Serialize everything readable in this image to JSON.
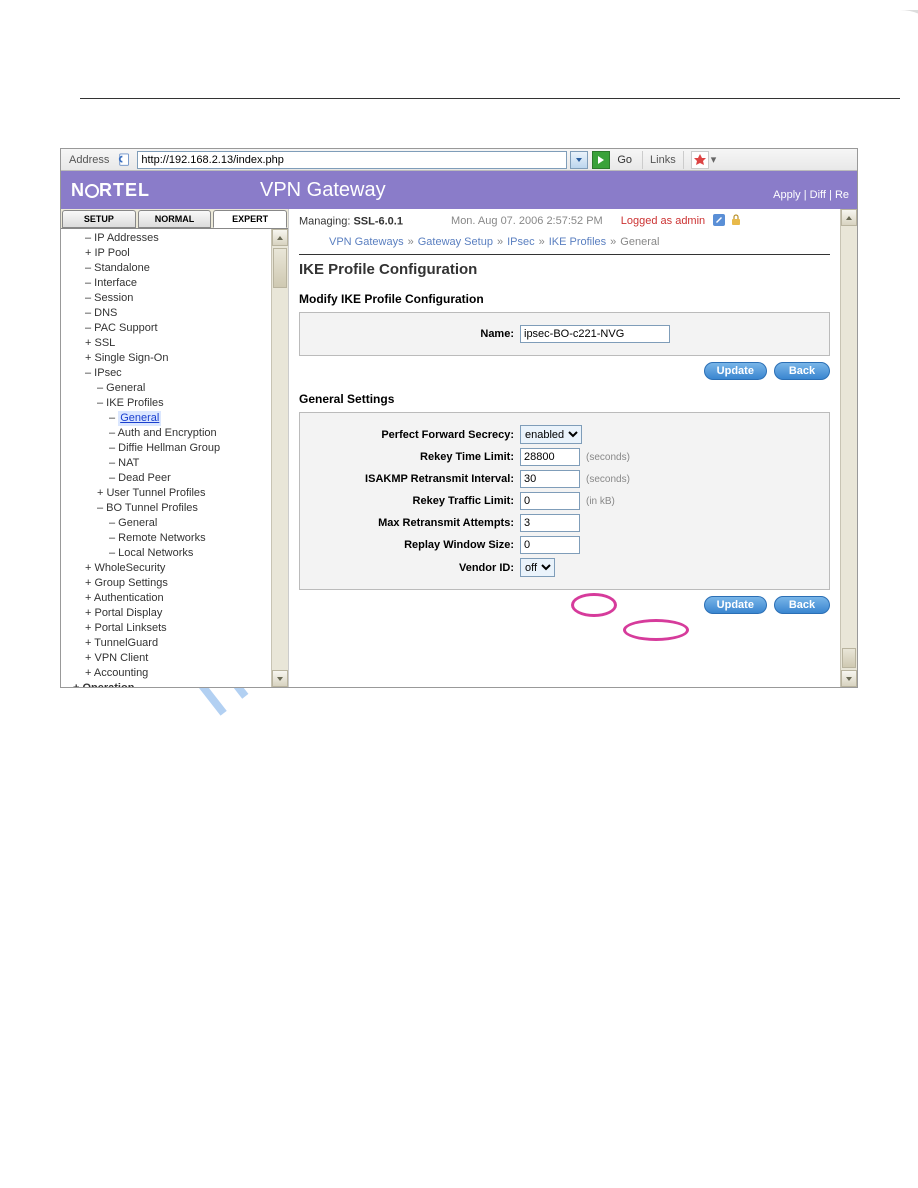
{
  "addressbar": {
    "label": "Address",
    "url": "http://192.168.2.13/index.php",
    "go": "Go",
    "links": "Links"
  },
  "banner": {
    "brand_prefix": "N",
    "brand_suffix": "RTEL",
    "title": "VPN Gateway",
    "apply": "Apply",
    "diff": "Diff",
    "re": "Re"
  },
  "tabs": {
    "setup": "SETUP",
    "normal": "NORMAL",
    "expert": "EXPERT"
  },
  "tree": {
    "items": [
      {
        "lvl": 2,
        "txt": "– IP Addresses"
      },
      {
        "lvl": 2,
        "txt": "+ IP Pool"
      },
      {
        "lvl": 2,
        "txt": "– Standalone"
      },
      {
        "lvl": 2,
        "txt": "– Interface"
      },
      {
        "lvl": 2,
        "txt": "– Session"
      },
      {
        "lvl": 2,
        "txt": "– DNS"
      },
      {
        "lvl": 2,
        "txt": "– PAC Support"
      },
      {
        "lvl": 2,
        "txt": "+ SSL"
      },
      {
        "lvl": 2,
        "txt": "+ Single Sign-On"
      },
      {
        "lvl": 2,
        "txt": "– IPsec"
      },
      {
        "lvl": 3,
        "txt": "– General"
      },
      {
        "lvl": 3,
        "txt": "– IKE Profiles"
      },
      {
        "lvl": 4,
        "txt": "General",
        "sel": true,
        "prefix": "– "
      },
      {
        "lvl": 4,
        "txt": "– Auth and Encryption"
      },
      {
        "lvl": 4,
        "txt": "– Diffie Hellman Group"
      },
      {
        "lvl": 4,
        "txt": "– NAT"
      },
      {
        "lvl": 4,
        "txt": "– Dead Peer"
      },
      {
        "lvl": 3,
        "txt": "+ User Tunnel Profiles"
      },
      {
        "lvl": 3,
        "txt": "– BO Tunnel Profiles"
      },
      {
        "lvl": 4,
        "txt": "– General"
      },
      {
        "lvl": 4,
        "txt": "– Remote Networks"
      },
      {
        "lvl": 4,
        "txt": "– Local Networks"
      },
      {
        "lvl": 2,
        "txt": "+ WholeSecurity"
      },
      {
        "lvl": 2,
        "txt": "+ Group Settings"
      },
      {
        "lvl": 2,
        "txt": "+ Authentication"
      },
      {
        "lvl": 2,
        "txt": "+ Portal Display"
      },
      {
        "lvl": 2,
        "txt": "+ Portal Linksets"
      },
      {
        "lvl": 2,
        "txt": "+ TunnelGuard"
      },
      {
        "lvl": 2,
        "txt": "+ VPN Client"
      },
      {
        "lvl": 2,
        "txt": "+ Accounting"
      },
      {
        "lvl": 1,
        "txt": "+ Operation",
        "bold": true
      }
    ]
  },
  "breadcrumb": {
    "managing_label": "Managing:",
    "managing_value": "SSL-6.0.1",
    "time": "Mon. Aug 07. 2006 2:57:52 PM",
    "login": "Logged as admin",
    "path": [
      "VPN Gateways",
      "Gateway Setup",
      "IPsec",
      "IKE Profiles",
      "General"
    ]
  },
  "page": {
    "title": "IKE Profile Configuration",
    "modify_title": "Modify IKE Profile Configuration",
    "general_title": "General Settings",
    "name_label": "Name:",
    "name_value": "ipsec-BO-c221-NVG",
    "pfs_label": "Perfect Forward Secrecy:",
    "pfs_value": "enabled",
    "rekey_time_label": "Rekey Time Limit:",
    "rekey_time_value": "28800",
    "rekey_time_unit": "(seconds)",
    "isakmp_label": "ISAKMP Retransmit Interval:",
    "isakmp_value": "30",
    "isakmp_unit": "(seconds)",
    "rekey_traffic_label": "Rekey Traffic Limit:",
    "rekey_traffic_value": "0",
    "rekey_traffic_unit": "(in kB)",
    "max_retrans_label": "Max Retransmit Attempts:",
    "max_retrans_value": "3",
    "replay_label": "Replay Window Size:",
    "replay_value": "0",
    "vendor_label": "Vendor ID:",
    "vendor_value": "off",
    "update": "Update",
    "back": "Back"
  },
  "watermark": "manualshive.com"
}
